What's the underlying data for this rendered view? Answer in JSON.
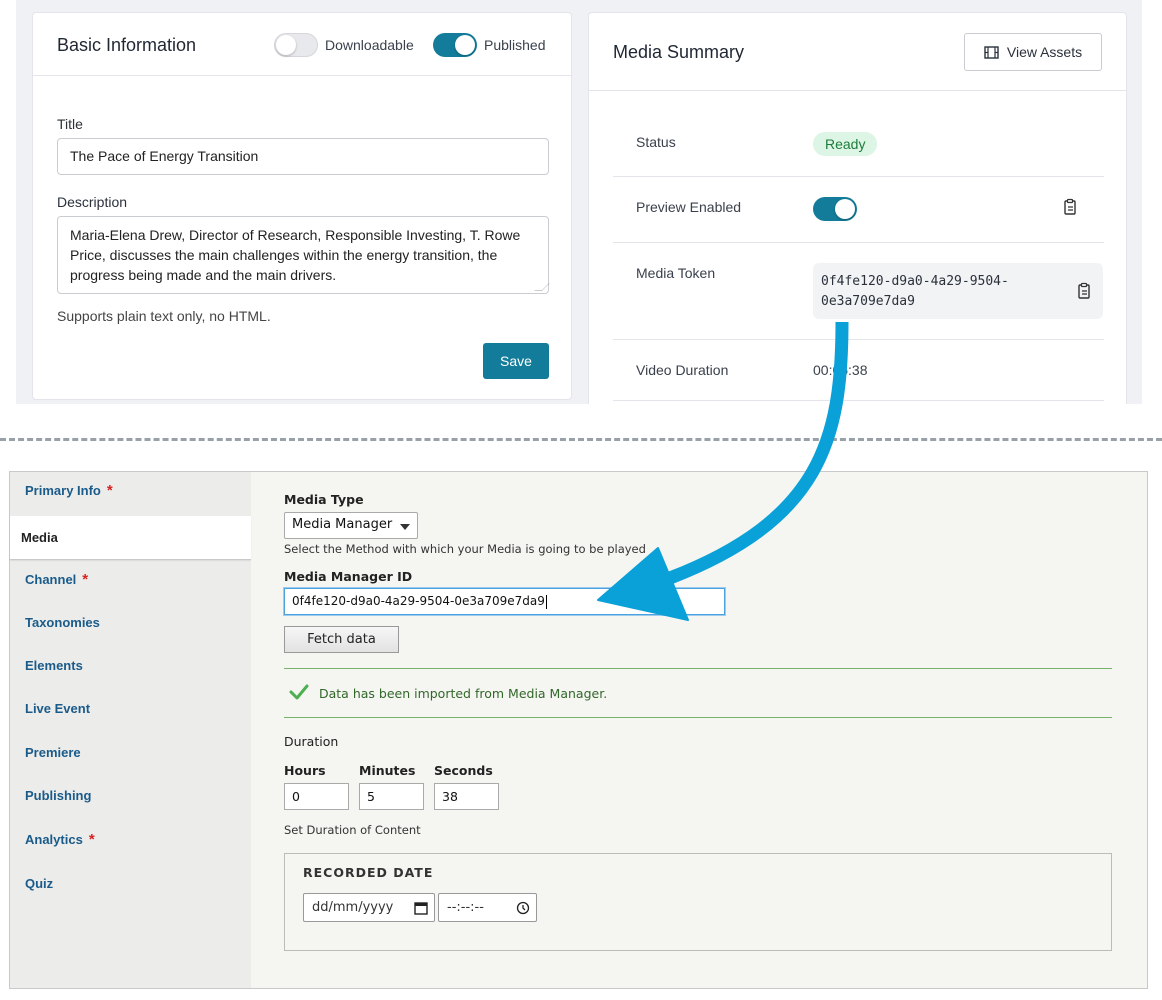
{
  "basic_info": {
    "title": "Basic Information",
    "downloadable_label": "Downloadable",
    "published_label": "Published",
    "title_label": "Title",
    "title_value": "The Pace of Energy Transition",
    "description_label": "Description",
    "description_value": "Maria-Elena Drew, Director of Research, Responsible Investing, T. Rowe Price, discusses the main challenges within the energy transition, the progress being made and the main drivers.",
    "help_text": "Supports plain text only, no HTML.",
    "save_label": "Save"
  },
  "media_summary": {
    "title": "Media Summary",
    "view_assets_label": "View Assets",
    "status_key": "Status",
    "status_value": "Ready",
    "preview_key": "Preview Enabled",
    "token_key": "Media Token",
    "token_line1": "0f4fe120-d9a0-4a29-9504-",
    "token_line2": "0e3a709e7da9",
    "duration_key": "Video Duration",
    "duration_value": "00:05:38"
  },
  "sidebar": {
    "items": [
      {
        "label": "Primary Info",
        "required": "*"
      },
      {
        "label": "Media"
      },
      {
        "label": "Channel",
        "required": "*"
      },
      {
        "label": "Taxonomies"
      },
      {
        "label": "Elements"
      },
      {
        "label": "Live Event"
      },
      {
        "label": "Premiere"
      },
      {
        "label": "Publishing"
      },
      {
        "label": "Analytics",
        "required": "*"
      },
      {
        "label": "Quiz"
      }
    ]
  },
  "media_form": {
    "media_type_label": "Media Type",
    "media_type_value": "Media Manager",
    "media_type_desc": "Select the Method with which your Media is going to be played",
    "mm_id_label": "Media Manager ID",
    "mm_id_value": "0f4fe120-d9a0-4a29-9504-0e3a709e7da9",
    "fetch_label": "Fetch data",
    "status_message": "Data has been imported from Media Manager.",
    "duration_label": "Duration",
    "hours_label": "Hours",
    "hours_value": "0",
    "minutes_label": "Minutes",
    "minutes_value": "5",
    "seconds_label": "Seconds",
    "seconds_value": "38",
    "duration_desc": "Set Duration of Content",
    "recorded_legend": "RECORDED DATE",
    "date_placeholder": "dd/mm/yyyy",
    "time_placeholder": "--:--:--"
  },
  "colors": {
    "accent": "#127c9a",
    "arrow": "#0aa0d8",
    "success": "#32672a",
    "required": "#d72222",
    "link": "#1a5b8a"
  }
}
